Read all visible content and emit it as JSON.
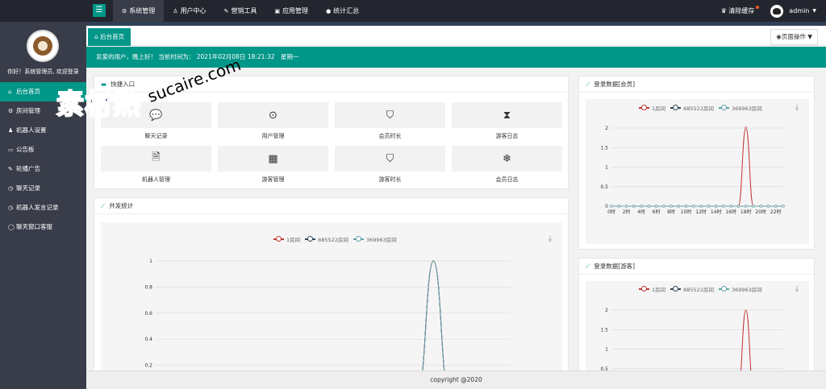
{
  "topbar": {
    "nav": [
      {
        "icon": "gear-icon",
        "glyph": "⚙",
        "label": "系统管理",
        "active": true
      },
      {
        "icon": "user-icon",
        "glyph": "♙",
        "label": "用户中心",
        "active": false
      },
      {
        "icon": "tag-icon",
        "glyph": "✎",
        "label": "营销工具",
        "active": false
      },
      {
        "icon": "app-icon",
        "glyph": "▣",
        "label": "应用管理",
        "active": false
      },
      {
        "icon": "chat-icon",
        "glyph": "●",
        "label": "统计汇总",
        "active": false
      }
    ],
    "clear_cache": "清除缓存",
    "clear_cache_glyph": "♛",
    "username": "admin"
  },
  "sidebar": {
    "welcome": "你好！系统管理员, 欢迎登录",
    "items": [
      {
        "glyph": "⌂",
        "label": "后台首页",
        "active": true
      },
      {
        "glyph": "⚙",
        "label": "房间管理",
        "active": false
      },
      {
        "glyph": "♟",
        "label": "机器人设置",
        "active": false
      },
      {
        "glyph": "▭",
        "label": "公告板",
        "active": false
      },
      {
        "glyph": "✎",
        "label": "轮播广告",
        "active": false
      },
      {
        "glyph": "◷",
        "label": "聊天记录",
        "active": false
      },
      {
        "glyph": "◷",
        "label": "机器人发言记录",
        "active": false
      },
      {
        "glyph": "◯",
        "label": "聊天窗口客服",
        "active": false
      }
    ]
  },
  "tabs": {
    "home": "后台首页",
    "page_ops": "页面操作"
  },
  "greeting": "亲爱的用户，晚上好！ 当前时间为： 2021年02月08日 18:21:32　星期一",
  "quick": {
    "title": "快捷入口",
    "items": [
      {
        "glyph": "💬",
        "label": "聊天记录"
      },
      {
        "glyph": "⊙",
        "label": "用户管理"
      },
      {
        "glyph": "⛉",
        "label": "会员时长"
      },
      {
        "glyph": "⧗",
        "label": "游客日志"
      },
      {
        "glyph": "🗎",
        "label": "机器人管理"
      },
      {
        "glyph": "▦",
        "label": "游客管理"
      },
      {
        "glyph": "⛉",
        "label": "游客时长"
      },
      {
        "glyph": "❄",
        "label": "会员日志"
      }
    ]
  },
  "concurrency": {
    "title": "并发统计"
  },
  "login_member": {
    "title": "登录数据[会员]"
  },
  "login_guest": {
    "title": "登录数据[游客]"
  },
  "footer": "copyright @2020",
  "colors": {
    "accent": "#009688",
    "series1": "#c23531",
    "series2": "#2f4554",
    "series3": "#61a0a8"
  },
  "chart_data": [
    {
      "type": "line",
      "title": "并发统计",
      "series": [
        {
          "name": "1房间",
          "values": [
            0,
            0,
            0,
            0,
            0,
            0,
            0,
            0,
            0,
            0,
            0,
            0,
            0,
            0,
            0,
            0,
            0,
            0,
            1,
            0,
            0,
            0,
            0,
            0
          ]
        },
        {
          "name": "885522房间",
          "values": [
            0,
            0,
            0,
            0,
            0,
            0,
            0,
            0,
            0,
            0,
            0,
            0,
            0,
            0,
            0,
            0,
            0,
            0,
            1,
            0,
            0,
            0,
            0,
            0
          ]
        },
        {
          "name": "369963房间",
          "values": [
            0,
            0,
            0,
            0,
            0,
            0,
            0,
            0,
            0,
            0,
            0,
            0,
            0,
            0,
            0,
            0,
            0,
            0,
            1,
            0,
            0,
            0,
            0,
            0
          ]
        }
      ],
      "y_ticks": [
        "0.2",
        "0.4",
        "0.6",
        "0.8",
        "1"
      ],
      "ylim": [
        0,
        1
      ],
      "grid": true,
      "legend": "top-center"
    },
    {
      "type": "line",
      "title": "登录数据[会员]",
      "categories": [
        "0时",
        "1时",
        "2时",
        "3时",
        "4时",
        "5时",
        "6时",
        "7时",
        "8时",
        "9时",
        "10时",
        "11时",
        "12时",
        "13时",
        "14时",
        "15时",
        "16时",
        "17时",
        "18时",
        "19时",
        "20时",
        "21时",
        "22时",
        "23时"
      ],
      "x_tick_labels": [
        "0时",
        "2时",
        "4时",
        "6时",
        "8时",
        "10时",
        "12时",
        "14时",
        "16时",
        "18时",
        "20时",
        "22时"
      ],
      "series": [
        {
          "name": "1房间",
          "values": [
            0,
            0,
            0,
            0,
            0,
            0,
            0,
            0,
            0,
            0,
            0,
            0,
            0,
            0,
            0,
            0,
            0,
            0,
            2,
            0,
            0,
            0,
            0,
            0
          ]
        },
        {
          "name": "885522房间",
          "values": [
            0,
            0,
            0,
            0,
            0,
            0,
            0,
            0,
            0,
            0,
            0,
            0,
            0,
            0,
            0,
            0,
            0,
            0,
            0,
            0,
            0,
            0,
            0,
            0
          ]
        },
        {
          "name": "369963房间",
          "values": [
            0,
            0,
            0,
            0,
            0,
            0,
            0,
            0,
            0,
            0,
            0,
            0,
            0,
            0,
            0,
            0,
            0,
            0,
            0,
            0,
            0,
            0,
            0,
            0
          ]
        }
      ],
      "y_ticks": [
        "0",
        "0.5",
        "1",
        "1.5",
        "2"
      ],
      "ylim": [
        0,
        2
      ],
      "grid": true,
      "legend": "top-center"
    },
    {
      "type": "line",
      "title": "登录数据[游客]",
      "series": [
        {
          "name": "1房间",
          "values": [
            0,
            0,
            0,
            0,
            0,
            0,
            0,
            0,
            0,
            0,
            0,
            0,
            0,
            0,
            0,
            0,
            0,
            0,
            2,
            0,
            0,
            0,
            0,
            0
          ]
        },
        {
          "name": "885522房间",
          "values": [
            0,
            0,
            0,
            0,
            0,
            0,
            0,
            0,
            0,
            0,
            0,
            0,
            0,
            0,
            0,
            0,
            0,
            0,
            0,
            0,
            0,
            0,
            0,
            0
          ]
        },
        {
          "name": "369963房间",
          "values": [
            0,
            0,
            0,
            0,
            0,
            0,
            0,
            0,
            0,
            0,
            0,
            0,
            0,
            0,
            0,
            0,
            0,
            0,
            0,
            0,
            0,
            0,
            0,
            0
          ]
        }
      ],
      "y_ticks": [
        "0.5",
        "1",
        "1.5",
        "2"
      ],
      "ylim": [
        0,
        2
      ],
      "grid": true,
      "legend": "top-center"
    }
  ],
  "watermark": {
    "cn": "素材熱",
    "en": "sucaire.com"
  }
}
